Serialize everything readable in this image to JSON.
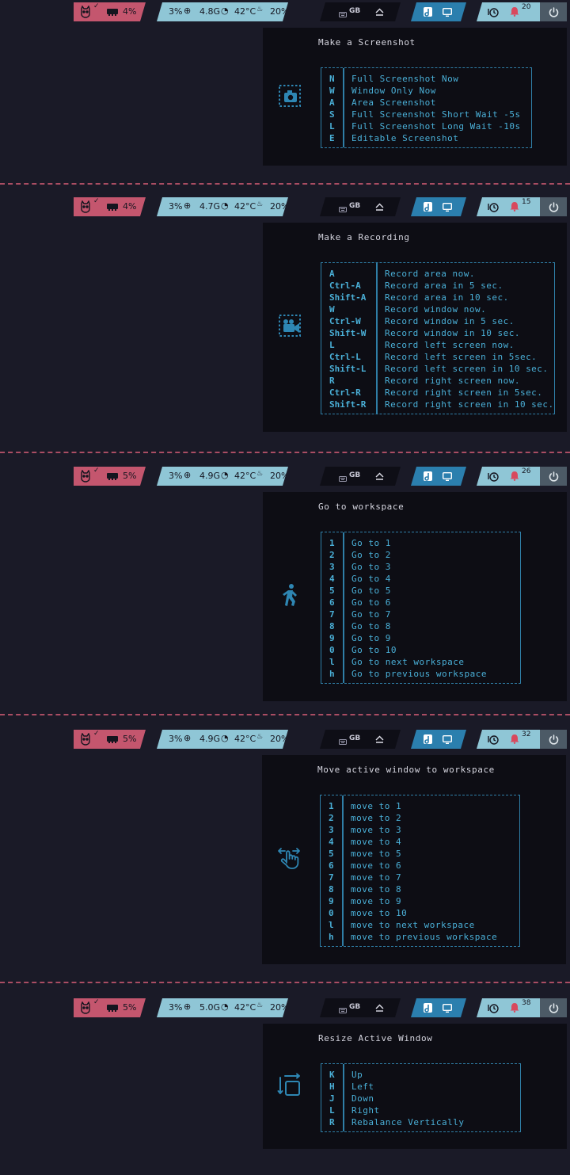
{
  "bars": [
    {
      "cpu": "4%",
      "ram_pct": "3%",
      "ram": "4.8G",
      "temp": "42°C",
      "bat": "20%",
      "kb": "GB",
      "notif": "20"
    },
    {
      "cpu": "4%",
      "ram_pct": "3%",
      "ram": "4.7G",
      "temp": "42°C",
      "bat": "20%",
      "kb": "GB",
      "notif": "15"
    },
    {
      "cpu": "5%",
      "ram_pct": "3%",
      "ram": "4.9G",
      "temp": "42°C",
      "bat": "20%",
      "kb": "GB",
      "notif": "26"
    },
    {
      "cpu": "5%",
      "ram_pct": "3%",
      "ram": "4.9G",
      "temp": "42°C",
      "bat": "20%",
      "kb": "GB",
      "notif": "32"
    },
    {
      "cpu": "5%",
      "ram_pct": "3%",
      "ram": "5.0G",
      "temp": "42°C",
      "bat": "20%",
      "kb": "GB",
      "notif": "38"
    }
  ],
  "menus": [
    {
      "title": "Make a Screenshot",
      "icon": "screenshot-icon",
      "rows": [
        {
          "key": "N",
          "desc": "Full Screenshot Now"
        },
        {
          "key": "W",
          "desc": "Window Only Now"
        },
        {
          "key": "A",
          "desc": "Area Screenshot"
        },
        {
          "key": "S",
          "desc": "Full Screenshot Short Wait -5s"
        },
        {
          "key": "L",
          "desc": "Full Screenshot Long Wait -10s"
        },
        {
          "key": "E",
          "desc": "Editable Screenshot"
        }
      ]
    },
    {
      "title": "Make a Recording",
      "icon": "screen-record-icon",
      "rows": [
        {
          "key": "A",
          "desc": "Record area now."
        },
        {
          "key": "Ctrl-A",
          "desc": "Record area in 5 sec."
        },
        {
          "key": "Shift-A",
          "desc": "Record area in 10 sec."
        },
        {
          "key": "W",
          "desc": "Record window now."
        },
        {
          "key": "Ctrl-W",
          "desc": "Record window in 5 sec."
        },
        {
          "key": "Shift-W",
          "desc": "Record window in 10 sec."
        },
        {
          "key": "L",
          "desc": "Record left screen now."
        },
        {
          "key": "Ctrl-L",
          "desc": "Record left screen in 5sec."
        },
        {
          "key": "Shift-L",
          "desc": "Record left screen in 10 sec."
        },
        {
          "key": "R",
          "desc": "Record right screen now."
        },
        {
          "key": "Ctrl-R",
          "desc": "Record right screen in 5sec."
        },
        {
          "key": "Shift-R",
          "desc": "Record right screen in 10 sec."
        }
      ]
    },
    {
      "title": "Go to workspace",
      "icon": "walking-person-icon",
      "rows": [
        {
          "key": "1",
          "desc": "Go to 1"
        },
        {
          "key": "2",
          "desc": "Go to 2"
        },
        {
          "key": "3",
          "desc": "Go to 3"
        },
        {
          "key": "4",
          "desc": "Go to 4"
        },
        {
          "key": "5",
          "desc": "Go to 5"
        },
        {
          "key": "6",
          "desc": "Go to 6"
        },
        {
          "key": "7",
          "desc": "Go to 7"
        },
        {
          "key": "8",
          "desc": "Go to 8"
        },
        {
          "key": "9",
          "desc": "Go to 9"
        },
        {
          "key": "0",
          "desc": "Go to 10"
        },
        {
          "key": "l",
          "desc": "Go to next workspace"
        },
        {
          "key": "h",
          "desc": "Go to previous workspace"
        }
      ]
    },
    {
      "title": "Move active window to workspace",
      "icon": "hand-swipe-icon",
      "rows": [
        {
          "key": "1",
          "desc": "move to 1"
        },
        {
          "key": "2",
          "desc": "move to 2"
        },
        {
          "key": "3",
          "desc": "move to 3"
        },
        {
          "key": "4",
          "desc": "move to 4"
        },
        {
          "key": "5",
          "desc": "move to 5"
        },
        {
          "key": "6",
          "desc": "move to 6"
        },
        {
          "key": "7",
          "desc": "move to 7"
        },
        {
          "key": "8",
          "desc": "move to 8"
        },
        {
          "key": "9",
          "desc": "move to 9"
        },
        {
          "key": "0",
          "desc": "move to 10"
        },
        {
          "key": "l",
          "desc": "move to next workspace"
        },
        {
          "key": "h",
          "desc": "move to previous workspace"
        }
      ]
    },
    {
      "title": "Resize Active Window",
      "icon": "resize-window-icon",
      "rows": [
        {
          "key": "K",
          "desc": "Up"
        },
        {
          "key": "H",
          "desc": "Left"
        },
        {
          "key": "J",
          "desc": "Down"
        },
        {
          "key": "L",
          "desc": "Right"
        },
        {
          "key": "R",
          "desc": "Rebalance Vertically"
        }
      ]
    }
  ]
}
